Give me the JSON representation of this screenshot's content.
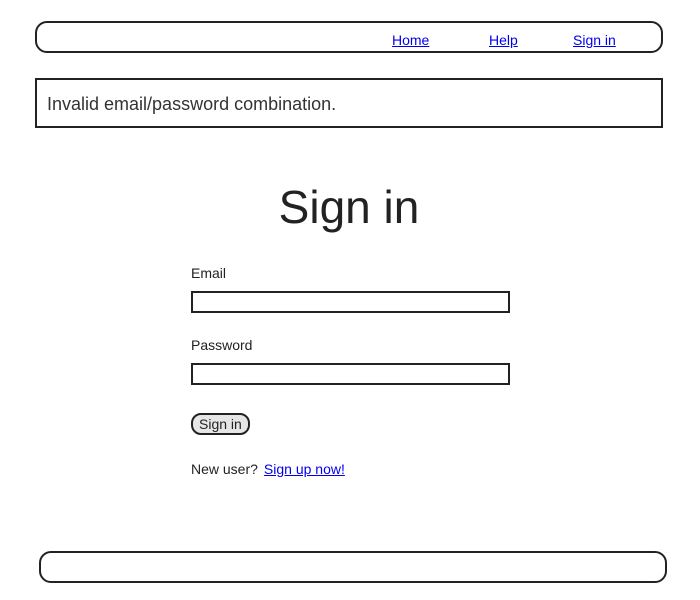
{
  "header": {
    "nav": [
      {
        "label": "Home"
      },
      {
        "label": "Help"
      },
      {
        "label": "Sign in"
      }
    ]
  },
  "flash": {
    "message": "Invalid email/password combination."
  },
  "main": {
    "title": "Sign in",
    "form": {
      "email_label": "Email",
      "email_value": "",
      "password_label": "Password",
      "password_value": "",
      "submit_label": "Sign in"
    },
    "signup": {
      "prompt": "New user?",
      "link_label": "Sign up now!"
    }
  }
}
